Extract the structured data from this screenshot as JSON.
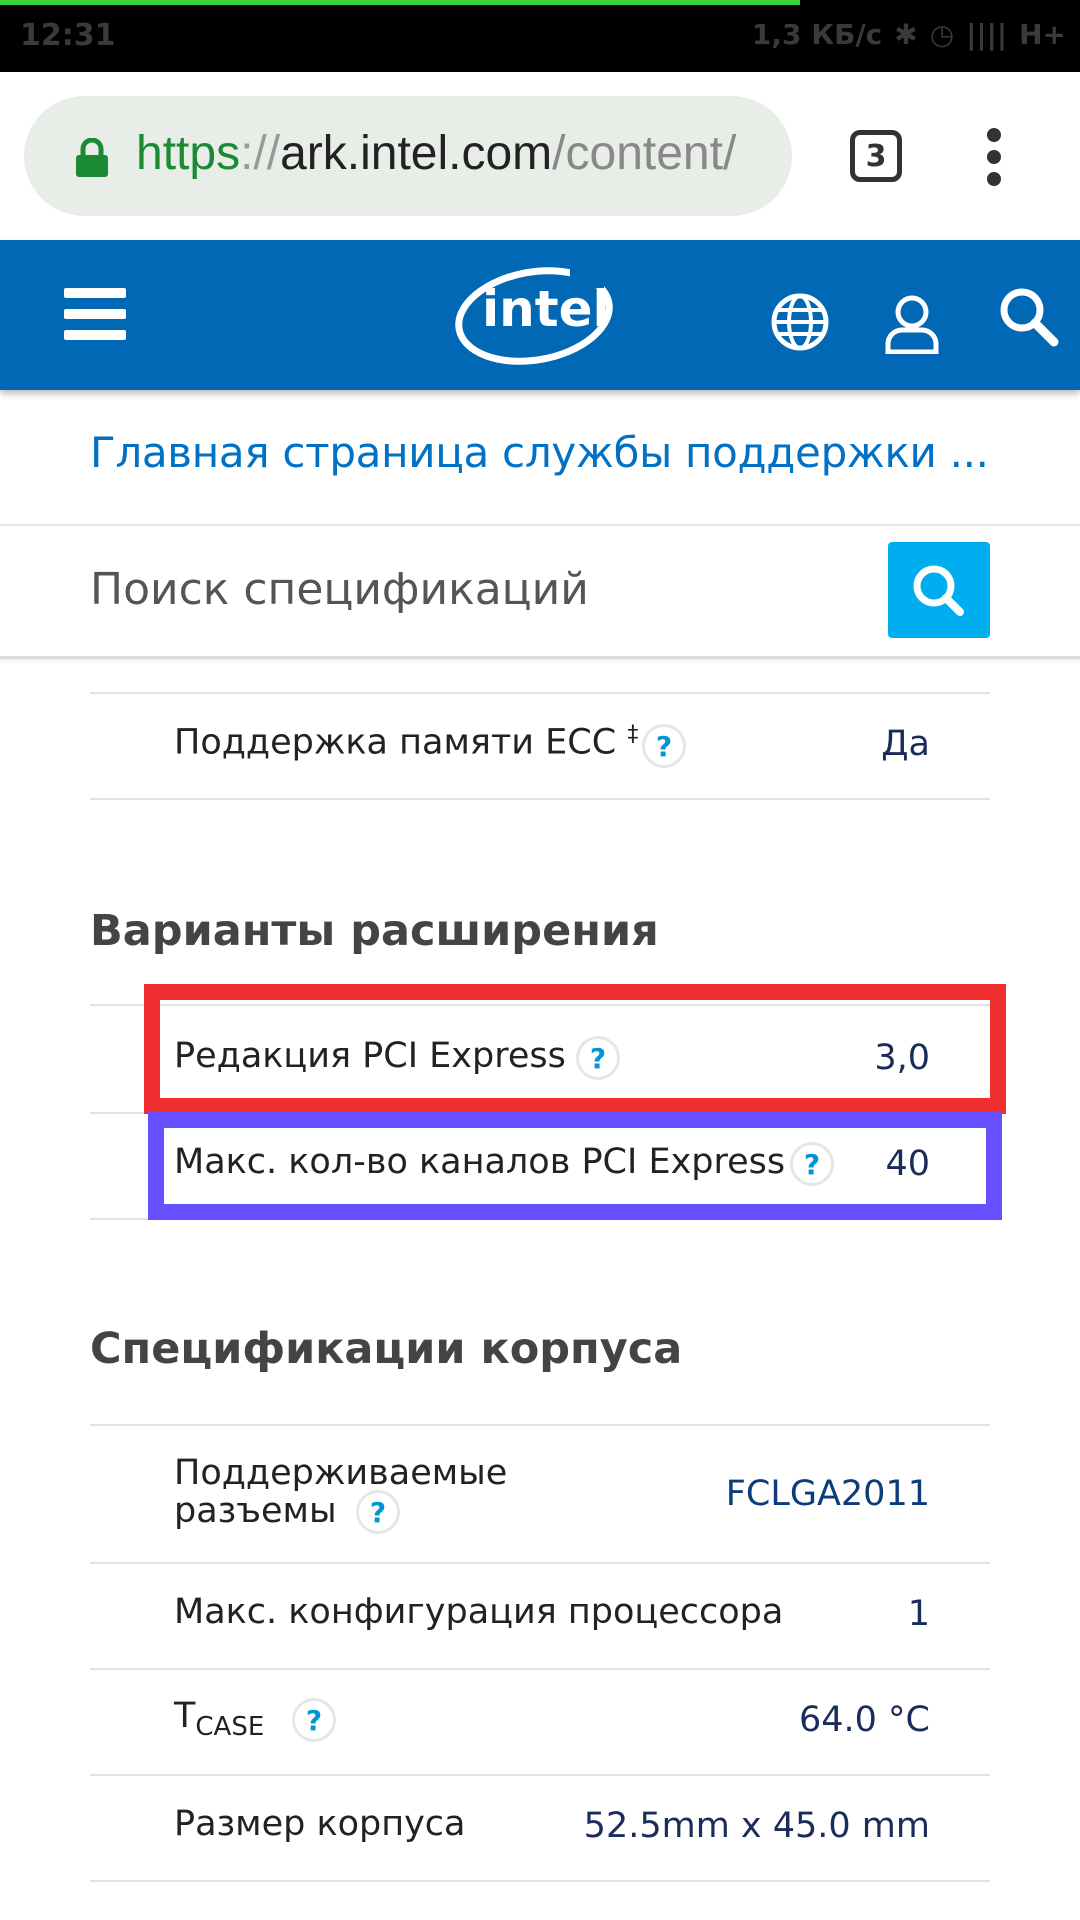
{
  "status_bar": {
    "time": "12:31",
    "network_speed": "1,3 КБ/с",
    "network_type": "H+"
  },
  "browser": {
    "url_scheme": "https",
    "url_sep": "://",
    "url_host": "ark.intel.com",
    "url_path": "/content/",
    "tab_count": "3"
  },
  "header": {
    "logo_text": "intel"
  },
  "breadcrumb": "Главная страница службы поддержки ...",
  "spec_search": {
    "label": "Поиск спецификаций"
  },
  "memory_section": {
    "rows": [
      {
        "label": "Поддержка памяти ECC",
        "superscript": "‡",
        "value": "Да"
      }
    ]
  },
  "expansion_section": {
    "title": "Варианты расширения",
    "rows": [
      {
        "label": "Редакция PCI Express",
        "value": "3,0"
      },
      {
        "label": "Макс. кол-во каналов PCI Express",
        "value": "40"
      }
    ]
  },
  "package_section": {
    "title": "Спецификации корпуса",
    "rows": [
      {
        "label_line1": "Поддерживаемые",
        "label_line2": "разъемы",
        "value": "FCLGA2011"
      },
      {
        "label": "Макс. конфигурация процессора",
        "value": "1"
      },
      {
        "label_main": "T",
        "label_sub": "CASE",
        "value": "64.0 °C"
      },
      {
        "label": "Размер корпуса",
        "value": "52.5mm x 45.0 mm"
      }
    ]
  },
  "colors": {
    "intel_blue": "#0068b5",
    "link_blue": "#0071c5",
    "search_button": "#00aeef",
    "annotation_red": "#f03030",
    "annotation_purple": "#6650ff"
  }
}
